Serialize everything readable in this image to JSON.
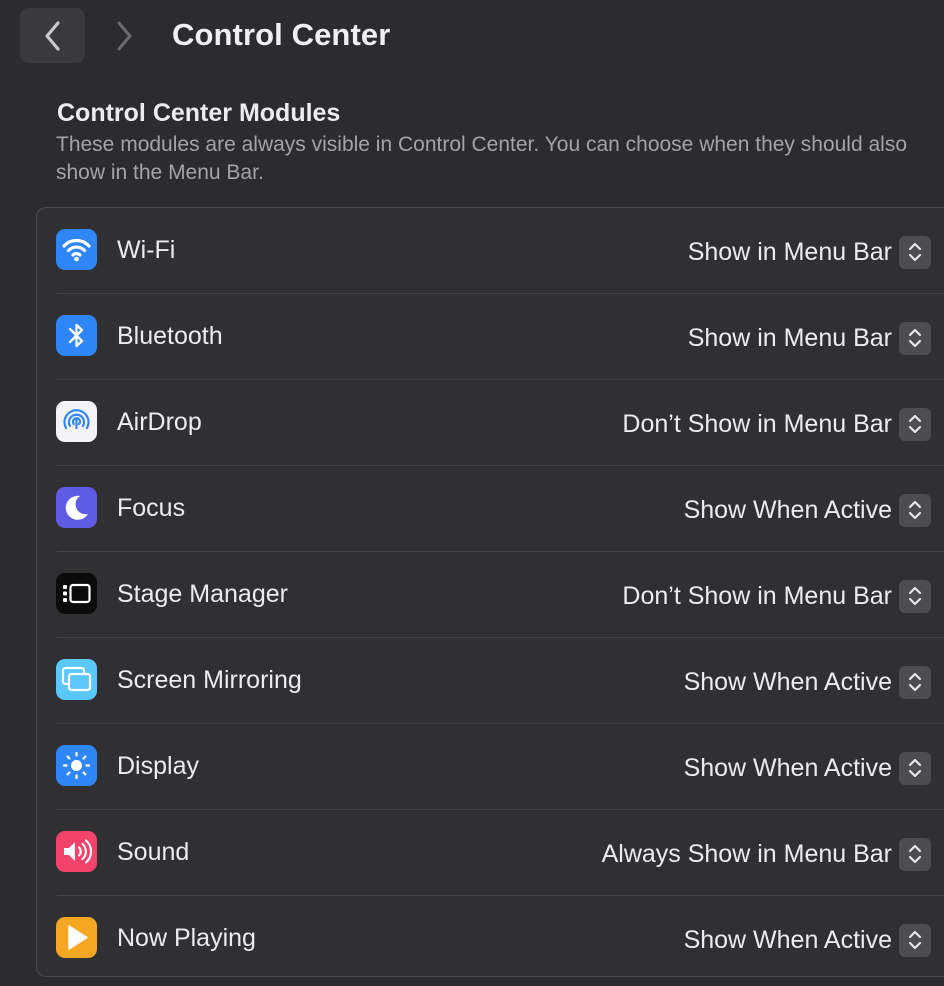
{
  "window": {
    "title": "Control Center",
    "back_icon": "chevron-left-icon",
    "forward_icon": "chevron-right-icon"
  },
  "section": {
    "title": "Control Center Modules",
    "description": "These modules are always visible in Control Center. You can choose when they should also show in the Menu Bar."
  },
  "modules": [
    {
      "label": "Wi-Fi",
      "value": "Show in Menu Bar",
      "icon": "wifi-icon",
      "icon_color": "#2f86f6"
    },
    {
      "label": "Bluetooth",
      "value": "Show in Menu Bar",
      "icon": "bluetooth-icon",
      "icon_color": "#2f86f6"
    },
    {
      "label": "AirDrop",
      "value": "Don’t Show in Menu Bar",
      "icon": "airdrop-icon",
      "icon_color": "#f4f4f6"
    },
    {
      "label": "Focus",
      "value": "Show When Active",
      "icon": "moon-icon",
      "icon_color": "#5e5ce6"
    },
    {
      "label": "Stage Manager",
      "value": "Don’t Show in Menu Bar",
      "icon": "stage-manager-icon",
      "icon_color": "#0b0b0c"
    },
    {
      "label": "Screen Mirroring",
      "value": "Show When Active",
      "icon": "screen-mirroring-icon",
      "icon_color": "#5ac8fa"
    },
    {
      "label": "Display",
      "value": "Show When Active",
      "icon": "brightness-icon",
      "icon_color": "#2f86f6"
    },
    {
      "label": "Sound",
      "value": "Always Show in Menu Bar",
      "icon": "speaker-icon",
      "icon_color": "#f2436a"
    },
    {
      "label": "Now Playing",
      "value": "Show When Active",
      "icon": "play-icon",
      "icon_color": "#f5a623"
    }
  ],
  "colors": {
    "background": "#2c2c2e",
    "panel": "#303033",
    "secondary_text": "#a3a3a8"
  }
}
